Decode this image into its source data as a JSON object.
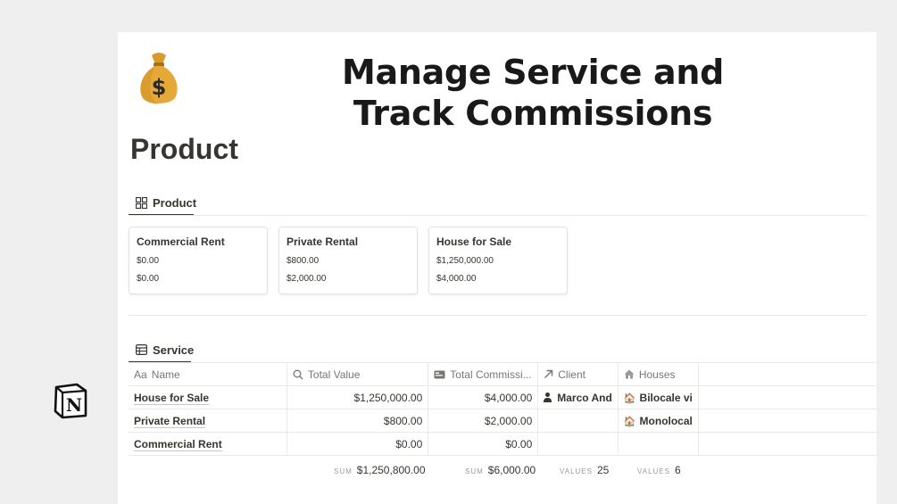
{
  "hero": {
    "title": "Manage Service and Track Commissions",
    "emoji": "money-bag"
  },
  "page": {
    "title": "Product"
  },
  "product_view": {
    "tab_label": "Product",
    "cards": [
      {
        "title": "Commercial Rent",
        "line1": "$0.00",
        "line2": "$0.00"
      },
      {
        "title": "Private Rental",
        "line1": "$800.00",
        "line2": "$2,000.00"
      },
      {
        "title": "House for Sale",
        "line1": "$1,250,000.00",
        "line2": "$4,000.00"
      }
    ]
  },
  "service_view": {
    "tab_label": "Service",
    "columns": {
      "name_prefix": "Aa",
      "name": "Name",
      "total_value": "Total Value",
      "total_commission": "Total Commissi...",
      "client": "Client",
      "houses": "Houses"
    },
    "rows": [
      {
        "name": "House for Sale",
        "total_value": "$1,250,000.00",
        "total_commission": "$4,000.00",
        "client": "Marco And",
        "houses": "Bilocale vi"
      },
      {
        "name": "Private Rental",
        "total_value": "$800.00",
        "total_commission": "$2,000.00",
        "client": "",
        "houses": "Monolocal"
      },
      {
        "name": "Commercial Rent",
        "total_value": "$0.00",
        "total_commission": "$0.00",
        "client": "",
        "houses": ""
      }
    ],
    "footer": {
      "sum_label": "SUM",
      "values_label": "VALUES",
      "total_value_sum": "$1,250,800.00",
      "total_commission_sum": "$6,000.00",
      "client_values": "25",
      "houses_values": "6"
    }
  },
  "icons": [
    "money-bag-icon",
    "gallery-icon",
    "table-icon",
    "search-icon",
    "id-card-icon",
    "arrow-up-right-icon",
    "house-icon",
    "person-icon",
    "notion-logo"
  ]
}
